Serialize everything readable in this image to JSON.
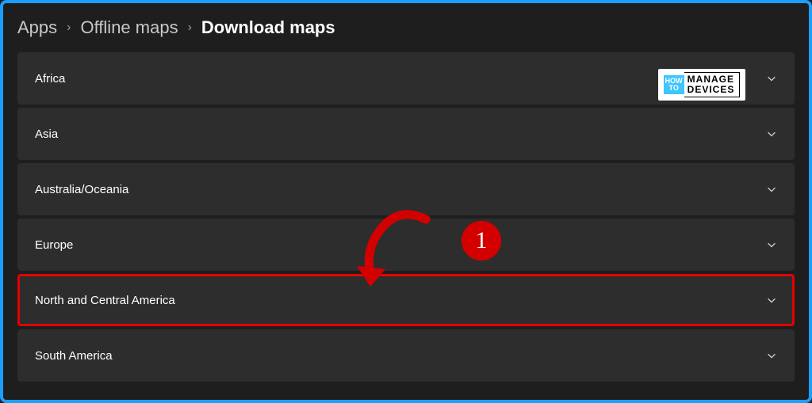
{
  "breadcrumb": {
    "level1": "Apps",
    "level2": "Offline maps",
    "level3": "Download maps"
  },
  "regions": [
    {
      "label": "Africa",
      "highlighted": false
    },
    {
      "label": "Asia",
      "highlighted": false
    },
    {
      "label": "Australia/Oceania",
      "highlighted": false
    },
    {
      "label": "Europe",
      "highlighted": false
    },
    {
      "label": "North and Central America",
      "highlighted": true
    },
    {
      "label": "South America",
      "highlighted": false
    }
  ],
  "annotation": {
    "badge_number": "1"
  },
  "watermark": {
    "left_top": "HOW",
    "left_bottom": "TO",
    "right_top": "MANAGE",
    "right_bottom": "DEVICES"
  }
}
